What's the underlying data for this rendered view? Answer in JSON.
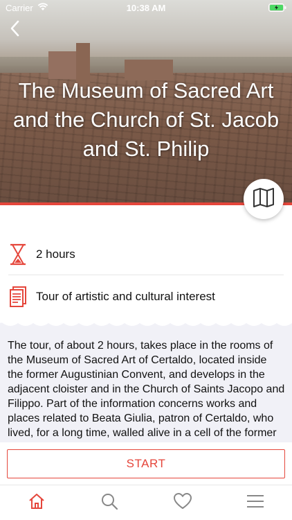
{
  "status_bar": {
    "carrier": "Carrier",
    "time": "10:38 AM"
  },
  "hero": {
    "title": "The Museum of Sacred Art and the Church of St. Jacob and St. Philip"
  },
  "info": {
    "duration": "2 hours",
    "type": "Tour of artistic and cultural interest"
  },
  "description": "The tour, of about 2 hours, takes place in the rooms of the Museum of Sacred Art of Certaldo, located inside the former Augustinian Convent, and develops in the adjacent cloister and in the Church of Saints Jacopo and Filippo. Part of the information concerns works and places related to Beata Giulia, patron of Certaldo, who lived, for a long time, walled alive in a cell of the former",
  "actions": {
    "start_label": "START"
  },
  "colors": {
    "accent": "#e5463b",
    "desc_bg": "#f1f1f7"
  },
  "icons": {
    "back": "chevron-left-icon",
    "map": "map-icon",
    "duration": "hourglass-icon",
    "type": "document-icon",
    "tabs": [
      "home-icon",
      "search-icon",
      "heart-icon",
      "menu-icon"
    ]
  }
}
